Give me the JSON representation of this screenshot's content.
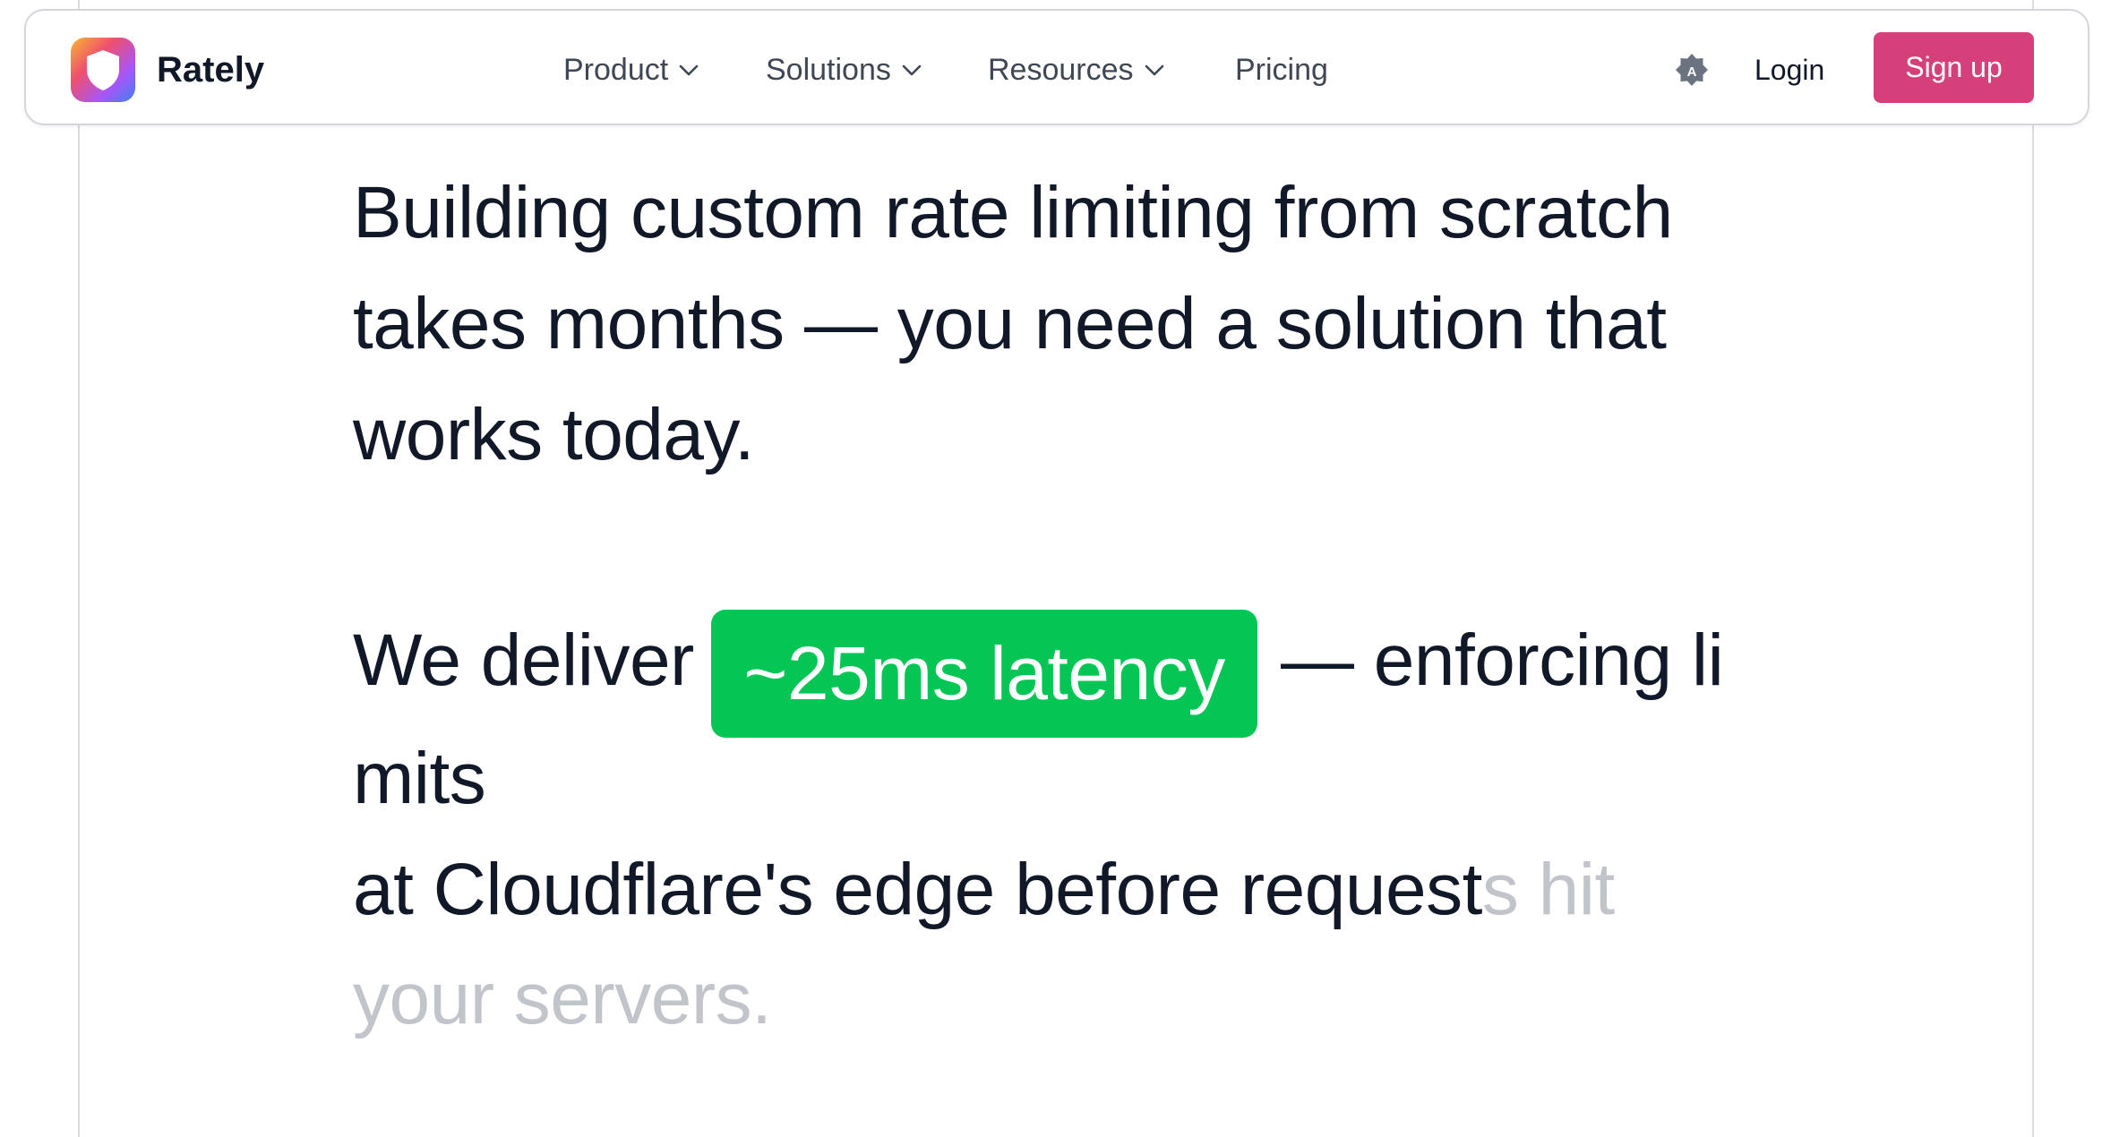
{
  "nav": {
    "brand": "Rately",
    "items": [
      {
        "label": "Product"
      },
      {
        "label": "Solutions"
      },
      {
        "label": "Resources"
      },
      {
        "label": "Pricing"
      }
    ],
    "login": "Login",
    "signup": "Sign up",
    "signup_color": "#d6407a",
    "theme_icon": "theme-toggle-icon"
  },
  "hero": {
    "line1": "Building custom rate limiting from scratch",
    "line2": "takes months — you need a solution that",
    "line3": "works today.",
    "line4_prefix": "We deliver",
    "highlight": "~25ms latency",
    "highlight_color": "#05c655",
    "line4_suffix": "— enforcing li",
    "line5": "mits",
    "line6_dark": "at Cloudflare's edge before request",
    "line6_dim": "s hit",
    "line7_dim": "your servers."
  }
}
